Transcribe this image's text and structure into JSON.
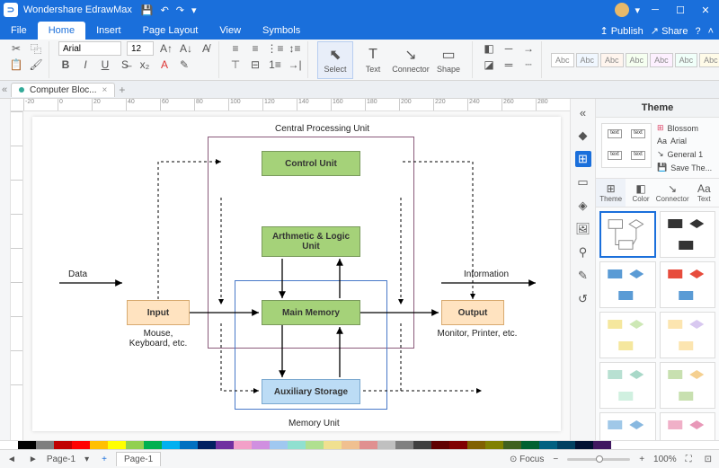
{
  "app": {
    "title": "Wondershare EdrawMax"
  },
  "menu": {
    "file": "File",
    "home": "Home",
    "insert": "Insert",
    "pagelayout": "Page Layout",
    "view": "View",
    "symbols": "Symbols",
    "publish": "Publish",
    "share": "Share"
  },
  "ribbon": {
    "font": "Arial",
    "size": "12",
    "select": "Select",
    "text": "Text",
    "connector": "Connector",
    "shape": "Shape",
    "abc": "Abc"
  },
  "doctab": {
    "name": "Computer Bloc..."
  },
  "ruler": {
    "marks": [
      "-20",
      "0",
      "20",
      "40",
      "60",
      "80",
      "100",
      "120",
      "140",
      "160",
      "180",
      "200",
      "220",
      "240",
      "260",
      "280"
    ]
  },
  "diagram": {
    "cpu": "Central Processing Unit",
    "control": "Control Unit",
    "alu": "Arthmetic & Logic Unit",
    "mainmem": "Main Memory",
    "aux": "Auxiliary Storage",
    "memunit": "Memory Unit",
    "input": "Input",
    "output": "Output",
    "data": "Data",
    "info": "Information",
    "inputdev": "Mouse, Keyboard, etc.",
    "outputdev": "Monitor, Printer, etc."
  },
  "panel": {
    "title": "Theme",
    "blossom": "Blossom",
    "arial": "Arial",
    "general": "General 1",
    "save": "Save The...",
    "tab_theme": "Theme",
    "tab_color": "Color",
    "tab_conn": "Connector",
    "tab_text": "Text",
    "pvtext": "text"
  },
  "status": {
    "page": "Page-1",
    "focus": "Focus",
    "zoom": "100%",
    "plus": "+",
    "minus": "−"
  }
}
